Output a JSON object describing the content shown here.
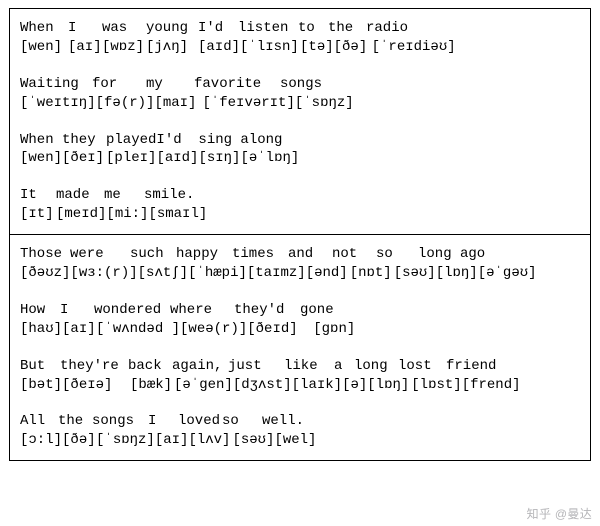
{
  "panels": [
    {
      "lines": [
        {
          "words": [
            "When",
            "I",
            "was",
            "young",
            "I'd",
            "listen",
            "to",
            "the",
            "radio"
          ],
          "phonetic": [
            "[wen]",
            "[aɪ]",
            "[wɒz]",
            "[jʌŋ]",
            "[aɪd]",
            "[ˈlɪsn]",
            "[tə]",
            "[ðə]",
            "[ˈreɪdiəʊ]"
          ],
          "widths": [
            48,
            34,
            44,
            52,
            40,
            60,
            30,
            38,
            80
          ]
        },
        {
          "words": [
            "Waiting",
            "for",
            "my",
            "favorite",
            "songs"
          ],
          "phonetic": [
            "[ˈweɪtɪŋ]",
            "[fə(r)]",
            "[maɪ]",
            "[ˈfeɪvərɪt]",
            "[ˈsɒŋz]"
          ],
          "widths": [
            72,
            54,
            48,
            86,
            60
          ]
        },
        {
          "words": [
            "When",
            "they",
            "played",
            "I'd",
            "sing",
            "along"
          ],
          "phonetic": [
            "[wen]",
            "[ðeɪ]",
            "[pleɪ]",
            "[aɪd]",
            "[sɪŋ]",
            "[əˈlɒŋ]"
          ],
          "widths": [
            42,
            44,
            50,
            42,
            42,
            60
          ]
        },
        {
          "words": [
            "It",
            "made",
            "me",
            "smile."
          ],
          "phonetic": [
            "[ɪt]",
            "[meɪd]",
            "[mi:]",
            "[smaɪl]"
          ],
          "widths": [
            36,
            48,
            40,
            60
          ]
        }
      ]
    },
    {
      "lines": [
        {
          "words": [
            "Those",
            "were",
            "such",
            "happy",
            "times",
            "and",
            "not",
            "so",
            "long",
            "ago"
          ],
          "phonetic": [
            "[ðəʊz]",
            "[wɜ:(r)]",
            "[sʌtʃ]",
            "[ˈhæpi]",
            "[taɪmz]",
            "[ənd]",
            "[nɒt]",
            "[səʊ]",
            "[lɒŋ]",
            "[əˈgəʊ]"
          ],
          "widths": [
            50,
            60,
            46,
            56,
            56,
            44,
            44,
            42,
            42,
            60
          ]
        },
        {
          "words": [
            "How",
            "I",
            "wondered",
            "where",
            "they'd",
            "gone"
          ],
          "phonetic": [
            "[haʊ]",
            "[aɪ]",
            "[ˈwʌndəd ]",
            "[weə(r)]",
            "[ðeɪd]",
            "[gɒn]"
          ],
          "widths": [
            40,
            34,
            76,
            64,
            66,
            48
          ]
        },
        {
          "words": [
            "But",
            "they're",
            "back",
            "again,",
            "just",
            "like",
            "a",
            "long",
            "lost",
            "friend"
          ],
          "phonetic": [
            "[bət]",
            "[ðeɪə]",
            "[bæk]",
            "[əˈgen]",
            "[dʒʌst]",
            "[laɪk]",
            "[ə]",
            "[lɒŋ]",
            "[lɒst]",
            "[frend]"
          ],
          "widths": [
            40,
            68,
            44,
            56,
            56,
            50,
            20,
            44,
            48,
            56
          ]
        },
        {
          "words": [
            "All",
            "the",
            "songs",
            "I",
            "loved",
            "so",
            "well."
          ],
          "phonetic": [
            "[ɔ:l]",
            "[ðə]",
            "[ˈsɒŋz]",
            "[aɪ]",
            "[lʌv]",
            "[səʊ]",
            "[wel]"
          ],
          "widths": [
            38,
            34,
            56,
            30,
            44,
            40,
            48
          ]
        }
      ]
    }
  ],
  "watermark": "知乎 @曼达"
}
